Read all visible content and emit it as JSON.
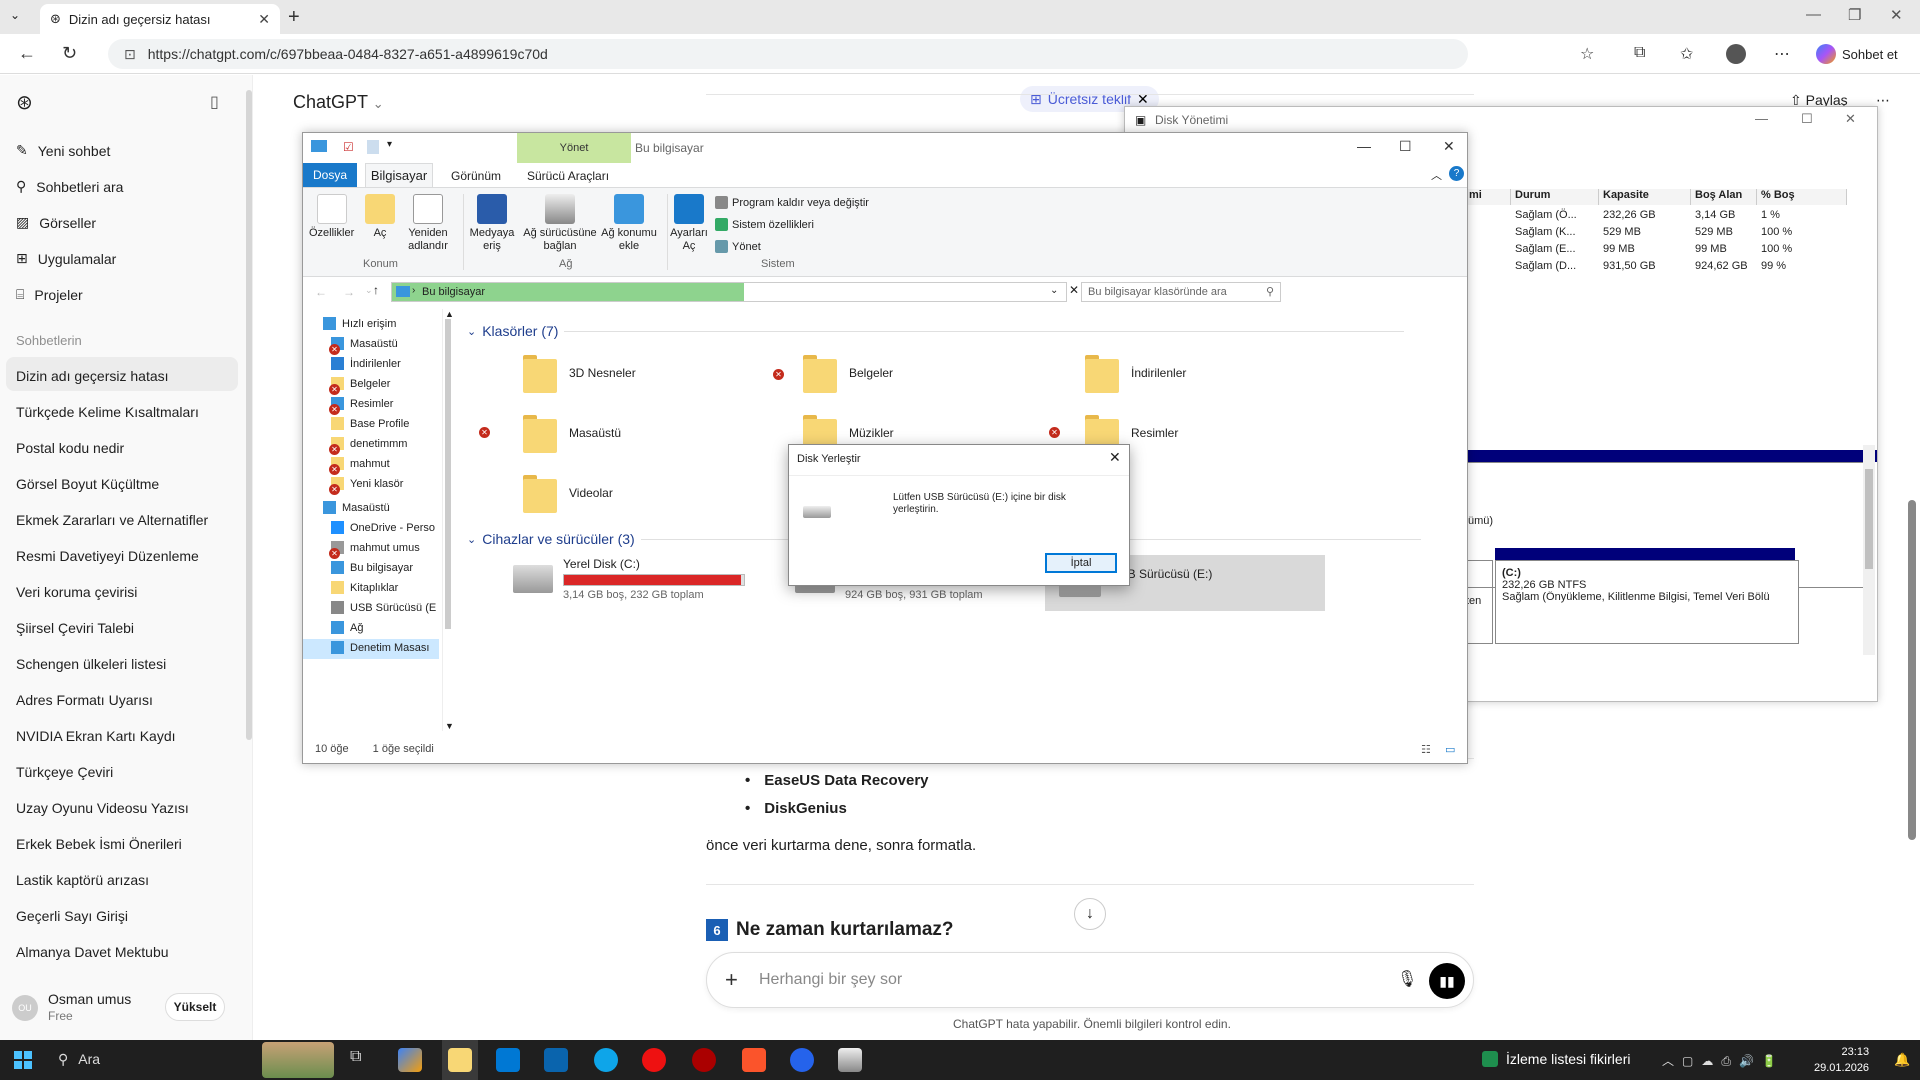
{
  "browser": {
    "tab_title": "Dizin adı geçersiz hatası",
    "url": "https://chatgpt.com/c/697bbeaa-0484-8327-a651-a4899619c70d",
    "chat_button": "Sohbet et"
  },
  "sidebar": {
    "actions": [
      {
        "label": "Yeni sohbet",
        "icon": "edit-icon"
      },
      {
        "label": "Sohbetleri ara",
        "icon": "search-icon"
      },
      {
        "label": "Görseller",
        "icon": "image-icon"
      },
      {
        "label": "Uygulamalar",
        "icon": "apps-icon"
      },
      {
        "label": "Projeler",
        "icon": "folder-icon"
      }
    ],
    "history_heading": "Sohbetlerin",
    "history": [
      "Dizin adı geçersiz hatası",
      "Türkçede Kelime Kısaltmaları",
      "Postal kodu nedir",
      "Görsel Boyut Küçültme",
      "Ekmek Zararları ve Alternatifler",
      "Resmi Davetiyeyi Düzenleme",
      "Veri koruma çevirisi",
      "Şiirsel Çeviri Talebi",
      "Schengen ülkeleri listesi",
      "Adres Formatı Uyarısı",
      "NVIDIA Ekran Kartı Kaydı",
      "Türkçeye Çeviri",
      "Uzay Oyunu Videosu Yazısı",
      "Erkek Bebek İsmi Önerileri",
      "Lastik kaptörü arızası",
      "Geçerli Sayı Girişi",
      "Almanya Davet Mektubu"
    ],
    "user": {
      "name": "Osman umus",
      "plan": "Free",
      "initials": "OU",
      "upgrade": "Yükselt"
    }
  },
  "chat": {
    "title": "ChatGPT",
    "offer": "Ücretsiz teklif",
    "share": "Paylaş",
    "bullets": [
      "EaseUS Data Recovery",
      "DiskGenius"
    ],
    "paragraph": "önce veri kurtarma dene, sonra formatla.",
    "heading_num": "6",
    "heading": "Ne zaman kurtarılamaz?",
    "placeholder": "Herhangi bir şey sor",
    "disclaimer": "ChatGPT hata yapabilir. Önemli bilgileri kontrol edin."
  },
  "disk_management": {
    "title": "Disk Yönetimi",
    "headers": [
      "mi",
      "Durum",
      "Kapasite",
      "Boş Alan",
      "% Boş"
    ],
    "rows": [
      [
        "",
        "Sağlam (Ö...",
        "232,26 GB",
        "3,14 GB",
        "1 %"
      ],
      [
        "",
        "Sağlam (K...",
        "529 MB",
        "529 MB",
        "100 %"
      ],
      [
        "",
        "Sağlam (E...",
        "99 MB",
        "99 MB",
        "100 %"
      ],
      [
        "",
        "Sağlam (D...",
        "931,50 GB",
        "924,62 GB",
        "99 %"
      ]
    ],
    "partial_label_1": "ümü)",
    "partial_label_2": "ten",
    "volume_label": "(C:)",
    "volume_size": "232,26 GB NTFS",
    "volume_status": "Sağlam (Önyükleme, Kilitlenme Bilgisi, Temel Veri Bölü"
  },
  "explorer": {
    "context_tab": "Yönet",
    "title": "Bu bilgisayar",
    "tabs": {
      "file": "Dosya",
      "computer": "Bilgisayar",
      "view": "Görünüm",
      "drive_tools": "Sürücü Araçları"
    },
    "ribbon": {
      "properties": "Özellikler",
      "open": "Aç",
      "rename": "Yeniden adlandır",
      "group_location": "Konum",
      "media": "Medyaya eriş",
      "map_drive": "Ağ sürücüsüne bağlan",
      "add_location": "Ağ konumu ekle",
      "group_network": "Ağ",
      "settings": "Ayarları Aç",
      "uninstall": "Program kaldır veya değiştir",
      "sys_props": "Sistem özellikleri",
      "manage": "Yönet",
      "group_system": "Sistem"
    },
    "path": "Bu bilgisayar",
    "search_placeholder": "Bu bilgisayar klasöründe ara",
    "nav": [
      "Hızlı erişim",
      "Masaüstü",
      "İndirilenler",
      "Belgeler",
      "Resimler",
      "Base Profile",
      "denetimmm",
      "mahmut",
      "Yeni klasör",
      "Masaüstü",
      "OneDrive - Perso",
      "mahmut umus",
      "Bu bilgisayar",
      "Kitaplıklar",
      "USB Sürücüsü (E",
      "Ağ",
      "Denetim Masası"
    ],
    "folders_heading": "Klasörler (7)",
    "folders": [
      "3D Nesneler",
      "Belgeler",
      "İndirilenler",
      "Masaüstü",
      "Müzikler",
      "Resimler",
      "Videolar"
    ],
    "devices_heading": "Cihazlar ve sürücüler (3)",
    "drives": [
      {
        "name": "Yerel Disk (C:)",
        "info": "3,14 GB boş, 232 GB toplam",
        "used": 0.986,
        "color": "#da2626"
      },
      {
        "name": "",
        "info": "924 GB boş, 931 GB toplam",
        "used": 0.007,
        "color": "#26a0da"
      },
      {
        "name": "USB Sürücüsü (E:)",
        "info": ""
      }
    ],
    "status_count": "10 öğe",
    "status_selected": "1 öğe seçildi"
  },
  "dialog": {
    "title": "Disk Yerleştir",
    "message": "Lütfen USB Sürücüsü (E:) içine bir disk yerleştirin.",
    "cancel": "İptal"
  },
  "taskbar": {
    "search": "Ara",
    "news": "İzleme listesi fikirleri",
    "time": "23:13",
    "date": "29.01.2026"
  }
}
